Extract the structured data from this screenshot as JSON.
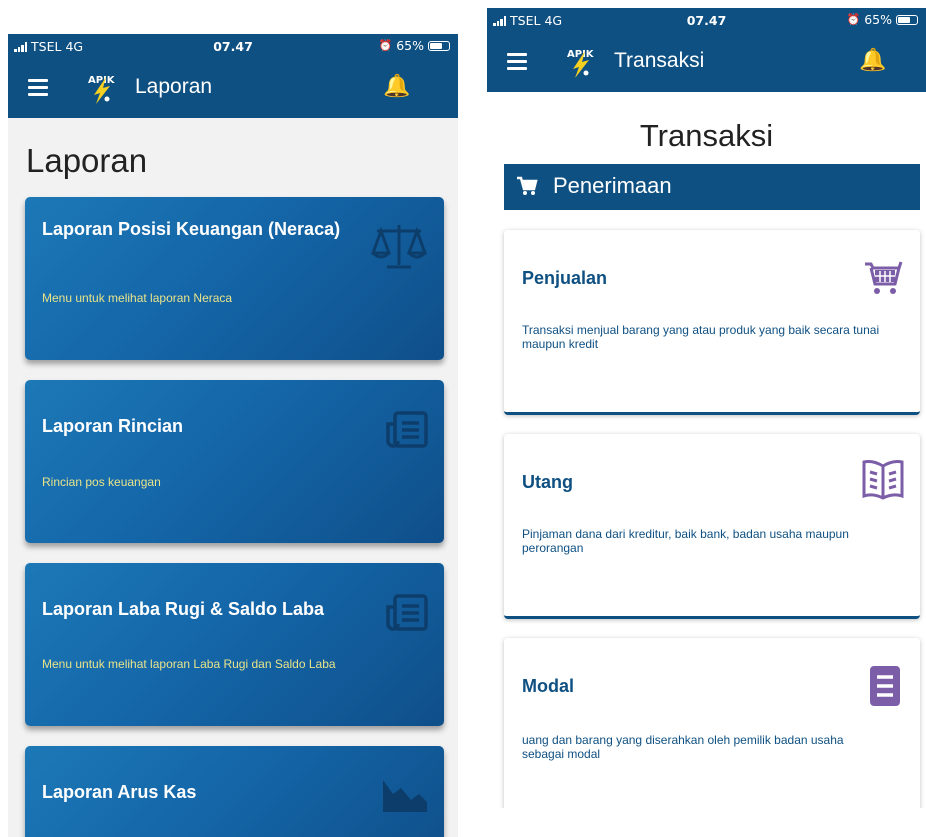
{
  "left_screen": {
    "status": {
      "carrier": "TSEL",
      "network": "4G",
      "time": "07.47",
      "battery": "65%"
    },
    "appbar": {
      "logo_text": "APIK",
      "title": "Laporan"
    },
    "page_title": "Laporan",
    "cards": [
      {
        "title": "Laporan Posisi Keuangan (Neraca)",
        "description": "Menu untuk melihat laporan Neraca",
        "icon": "balance-scale-icon"
      },
      {
        "title": "Laporan Rincian",
        "description": "Rincian pos keuangan",
        "icon": "newspaper-icon"
      },
      {
        "title": "Laporan Laba Rugi & Saldo Laba",
        "description": "Menu untuk melihat laporan Laba Rugi dan Saldo Laba",
        "icon": "newspaper-icon"
      },
      {
        "title": "Laporan Arus Kas",
        "description": "",
        "icon": "area-chart-icon"
      }
    ]
  },
  "right_screen": {
    "status": {
      "carrier": "TSEL",
      "network": "4G",
      "time": "07.47",
      "battery": "65%"
    },
    "appbar": {
      "logo_text": "APIK",
      "title": "Transaksi"
    },
    "page_title": "Transaksi",
    "section": {
      "title": "Penerimaan",
      "icon": "cart-icon"
    },
    "cards": [
      {
        "title": "Penjualan",
        "description": "Transaksi menjual barang yang atau produk yang baik secara tunai maupun kredit",
        "icon": "shopping-cart-icon"
      },
      {
        "title": "Utang",
        "description": "Pinjaman dana dari kreditur, baik bank, badan usaha maupun perorangan",
        "icon": "book-icon"
      },
      {
        "title": "Modal",
        "description": "uang dan barang yang diserahkan oleh pemilik badan usaha sebagai modal",
        "icon": "document-list-icon"
      }
    ]
  },
  "colors": {
    "primary": "#0f5082",
    "card_gradient_start": "#1d78b6",
    "desc_yellow": "#e8e38a",
    "icon_purple": "#7b5ea7"
  }
}
